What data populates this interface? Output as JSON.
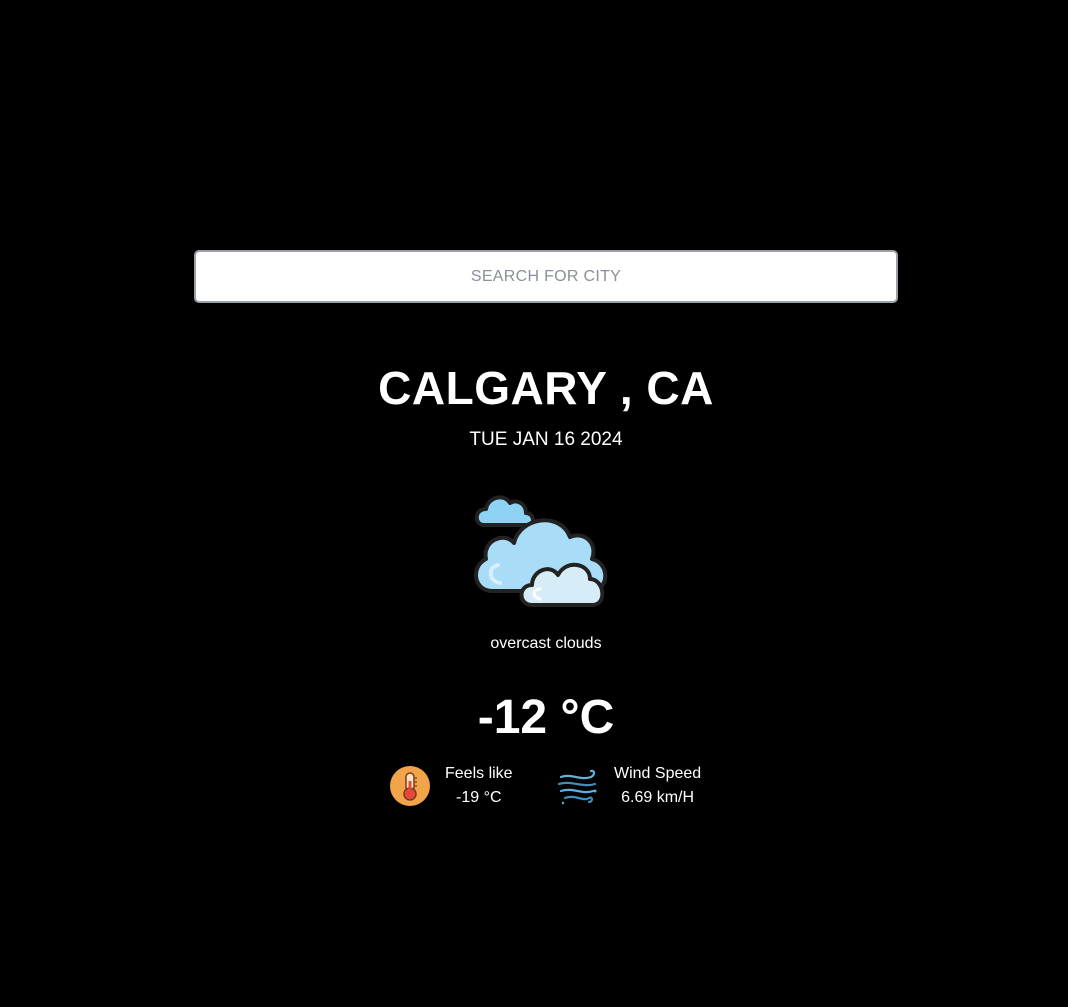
{
  "search": {
    "placeholder": "SEARCH FOR CITY"
  },
  "location": {
    "city": "CALGARY , CA",
    "date": "TUE JAN 16 2024"
  },
  "weather": {
    "icon": "overcast-clouds-icon",
    "description": "overcast clouds",
    "temperature": "-12 °C"
  },
  "details": {
    "feels_like": {
      "label": "Feels like",
      "value": "-19 °C",
      "icon": "thermometer-icon"
    },
    "wind_speed": {
      "label": "Wind Speed",
      "value": "6.69 km/H",
      "icon": "wind-icon"
    }
  },
  "colors": {
    "background": "#000000",
    "text": "#ffffff",
    "cloud_light": "#bfe6fb",
    "cloud_mid": "#8fd3f4",
    "thermometer_bg": "#f2a44a",
    "thermometer_red": "#e8483b",
    "wind_blue": "#5fb3d9"
  }
}
